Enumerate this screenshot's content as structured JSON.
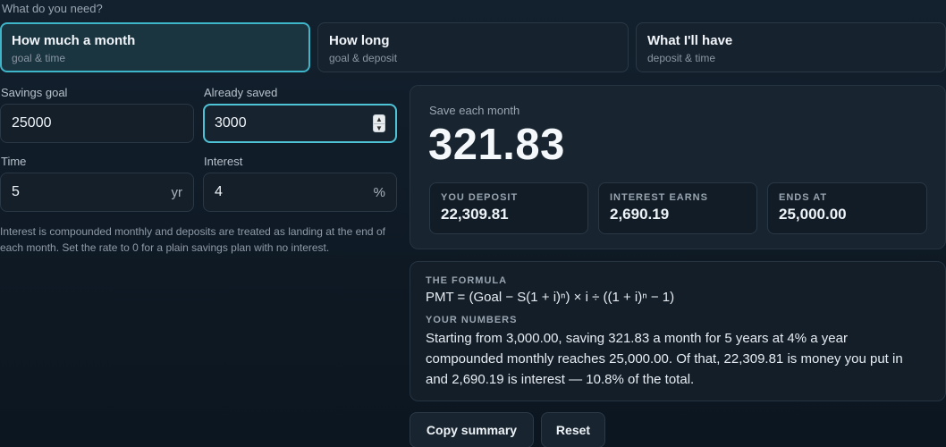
{
  "prompt": "What do you need?",
  "modes": [
    {
      "title": "How much a month",
      "sub": "goal & time"
    },
    {
      "title": "How long",
      "sub": "goal & deposit"
    },
    {
      "title": "What I'll have",
      "sub": "deposit & time"
    }
  ],
  "fields": {
    "goal": {
      "label": "Savings goal",
      "value": "25000"
    },
    "saved": {
      "label": "Already saved",
      "value": "3000"
    },
    "time": {
      "label": "Time",
      "value": "5",
      "unit": "yr"
    },
    "interest": {
      "label": "Interest",
      "value": "4",
      "unit": "%"
    }
  },
  "help": "Interest is compounded monthly and deposits are treated as landing at the end of each month. Set the rate to 0 for a plain savings plan with no interest.",
  "result": {
    "label": "Save each month",
    "value": "321.83",
    "stats": [
      {
        "key": "YOU DEPOSIT",
        "value": "22,309.81"
      },
      {
        "key": "INTEREST EARNS",
        "value": "2,690.19"
      },
      {
        "key": "ENDS AT",
        "value": "25,000.00"
      }
    ]
  },
  "formula": {
    "heading": "THE FORMULA",
    "text": "PMT = (Goal − S(1 + i)ⁿ) × i ÷ ((1 + i)ⁿ − 1)",
    "numbers_heading": "YOUR NUMBERS",
    "numbers_text": "Starting from 3,000.00, saving 321.83 a month for 5 years at 4% a year compounded monthly reaches 25,000.00. Of that, 22,309.81 is money you put in and 2,690.19 is interest — 10.8% of the total."
  },
  "buttons": {
    "copy": "Copy summary",
    "reset": "Reset"
  },
  "icons": {
    "spinner": "number-spinner-icon"
  },
  "colors": {
    "accent": "#3fb5c9",
    "background": "#0f1b27"
  }
}
